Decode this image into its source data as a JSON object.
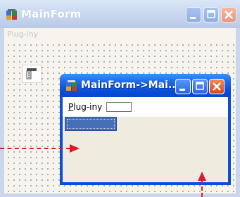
{
  "outer_window": {
    "title": "MainForm",
    "menu_label": "Plug-iny",
    "icon": "app-icon"
  },
  "component_tray": {
    "icon": "menustrip-component-icon"
  },
  "child_window": {
    "title": "MainForm->Mai...",
    "menu_label": "Plug-iny",
    "menu_label_underline": "P",
    "icon": "app-icon"
  },
  "caption_buttons": [
    "minimize-icon",
    "maximize-icon",
    "close-icon"
  ],
  "colors": {
    "child_titlebar": "#0b4fdb",
    "close_button": "#d6461b",
    "annotation_arrow": "#e0182a",
    "selection": "#476fb8"
  }
}
